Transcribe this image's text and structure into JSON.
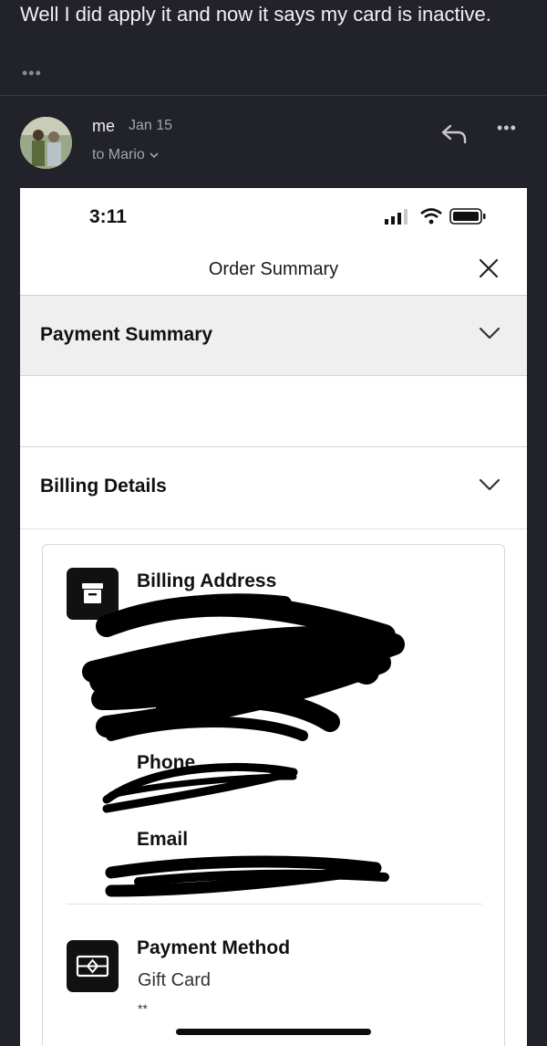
{
  "message": {
    "previous_text": "Well I did apply it and now it says my card is inactive.",
    "more_dots": "•••"
  },
  "header": {
    "sender": "me",
    "date": "Jan 15",
    "to_line": "to Mario",
    "more_dots": "•••"
  },
  "screenshot": {
    "time": "3:11",
    "nav_title": "Order Summary",
    "sections": {
      "payment_summary": "Payment Summary",
      "billing_details": "Billing Details"
    },
    "billing_address_title": "Billing Address",
    "phone_label": "Phone",
    "email_label": "Email",
    "payment_method_title": "Payment Method",
    "payment_method_value": "Gift Card",
    "payment_masked": "**"
  }
}
